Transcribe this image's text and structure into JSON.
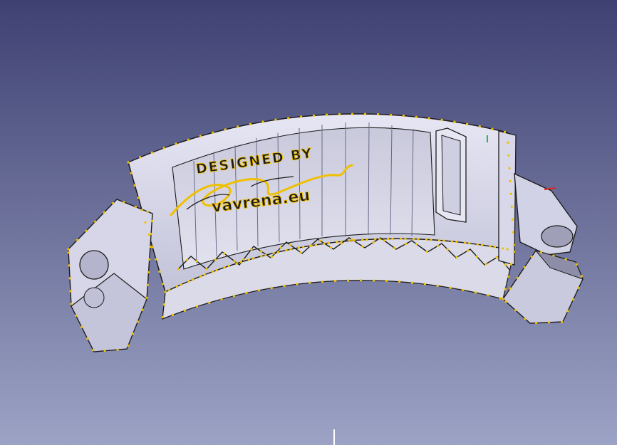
{
  "view": {
    "background_top": "#3e4172",
    "background_bottom": "#9da3c5"
  },
  "model": {
    "engraving_line1": "DESIGNED BY",
    "engraving_line2": "vavrena.eu",
    "edge_color": "#1d1d1d",
    "vertex_color": "#f0c000",
    "face_color": "#d9d9ec",
    "face_shadow": "#a8a8c0"
  },
  "axis_colors": {
    "x": "#e02020",
    "y": "#20c040",
    "z": "#ffffff"
  }
}
